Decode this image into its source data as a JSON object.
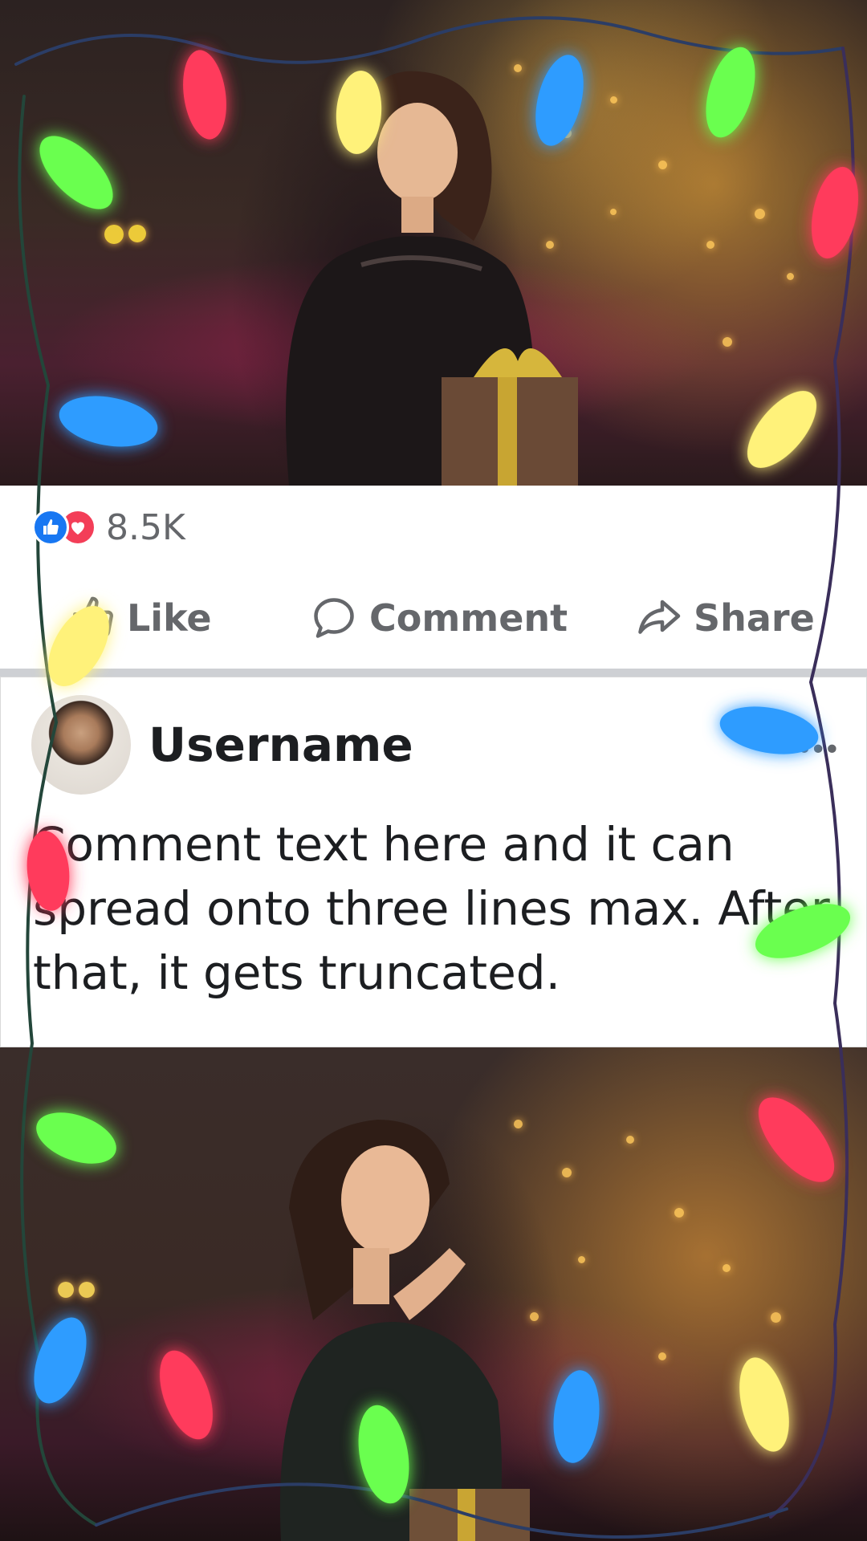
{
  "post": {
    "reaction_count": "8.5K",
    "actions": {
      "like_label": "Like",
      "comment_label": "Comment",
      "share_label": "Share"
    }
  },
  "comment": {
    "username": "Username",
    "text": "Comment text here and it can spread onto three lines max. After that, it gets truncated.",
    "more_label": "•••"
  },
  "colors": {
    "like_blue": "#1877f2",
    "love_red": "#f33e58",
    "action_gray": "#65676b",
    "text_dark": "#1c1e21",
    "divider": "#ced0d4",
    "light_red": "#ff3b5c",
    "light_yellow": "#fff27a",
    "light_blue": "#2d9cff",
    "light_green": "#6bff4f"
  },
  "icons": [
    "like-icon",
    "love-icon",
    "thumbs-up-icon",
    "speech-bubble-icon",
    "share-arrow-icon",
    "more-dots-icon"
  ]
}
